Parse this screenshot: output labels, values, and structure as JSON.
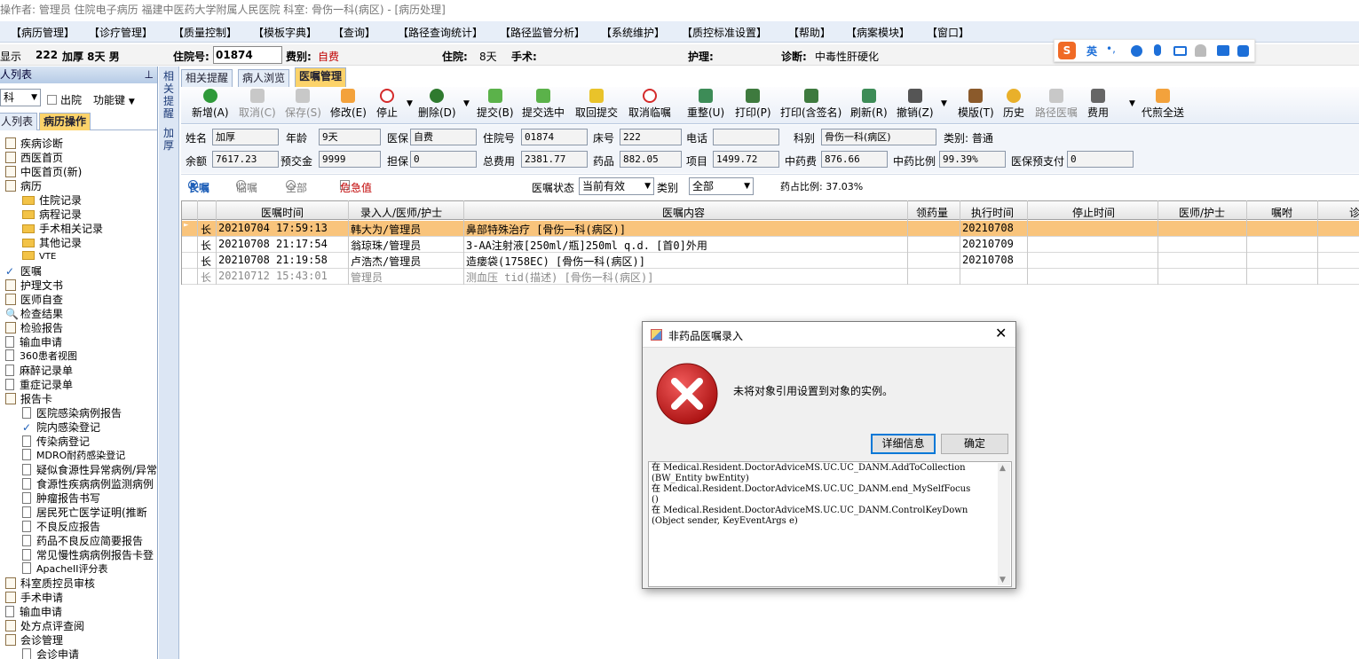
{
  "window": {
    "title": "操作者: 管理员 住院电子病历  福建中医药大学附属人民医院  科室: 骨伤一科(病区) - [病历处理]"
  },
  "menu": [
    "【病历管理】",
    "【诊疗管理】",
    "【质量控制】",
    "【模板字典】",
    "【查询】",
    "【路径查询统计】",
    "【路径监管分析】",
    "【系统维护】",
    "【质控标准设置】",
    "【帮助】",
    "【病案模块】",
    "【窗口】"
  ],
  "infobar": {
    "show": "显示",
    "bed": "222",
    "name_age": "加厚 8天 男",
    "inpatient_label": "住院号:",
    "inpatient_no": "01874",
    "fee_label": "费别:",
    "fee_value": "自费",
    "stay_label": "住院:",
    "stay_value": "8天",
    "surgery_label": "手术:",
    "nursing_label": "护理:",
    "diag_label": "诊断:",
    "diag_value": "中毒性肝硬化"
  },
  "ime": {
    "label": "英"
  },
  "sidebar": {
    "header": "人列表",
    "dept": "科",
    "discharged": "出院",
    "function_key": "功能键",
    "tab_patients": "人列表",
    "tab_ops": "病历操作",
    "items": [
      "疾病诊断",
      "西医首页",
      "中医首页(新)",
      "病历",
      "住院记录",
      "病程记录",
      "手术相关记录",
      "其他记录",
      "VTE",
      "医嘱",
      "护理文书",
      "医师自查",
      "检查结果",
      "检验报告",
      "输血申请",
      "360患者视图",
      "麻醉记录单",
      "重症记录单",
      "报告卡",
      "医院感染病例报告",
      "院内感染登记",
      "传染病登记",
      "MDRO耐药感染登记",
      "疑似食源性异常病例/异常",
      "食源性疾病病例监测病例",
      "肿瘤报告书写",
      "居民死亡医学证明(推断",
      "不良反应报告",
      "药品不良反应简要报告",
      "常见慢性病病例报告卡登",
      "ApacheII评分表",
      "科室质控员审核",
      "手术申请",
      "输血申请",
      "处方点评查阅",
      "会诊管理",
      "会诊申请"
    ]
  },
  "vstrip": {
    "remind": "相关提醒",
    "name": "加厚"
  },
  "tabs": [
    "相关提醒",
    "病人浏览",
    "医嘱管理"
  ],
  "toolbar": [
    "新增(A)",
    "取消(C)",
    "保存(S)",
    "修改(E)",
    "停止",
    "删除(D)",
    "提交(B)",
    "提交选中",
    "取回提交",
    "取消临嘱",
    "重整(U)",
    "打印(P)",
    "打印(含签名)",
    "刷新(R)",
    "撤销(Z)",
    "模版(T)",
    "历史",
    "路径医嘱",
    "费用",
    "代煎全送"
  ],
  "form": {
    "name_label": "姓名",
    "name": "加厚",
    "age_label": "年龄",
    "age": "9天",
    "ins_label": "医保",
    "ins": "自费",
    "inpatient_label": "住院号",
    "inpatient": "01874",
    "bed_label": "床号",
    "bed": "222",
    "phone_label": "电话",
    "phone": "",
    "dept_label": "科别",
    "dept": "骨伤一科(病区)",
    "category": "类别: 普通",
    "balance_label": "余额",
    "balance": "7617.23",
    "prepay_label": "预交金",
    "prepay": "9999",
    "guarantee_label": "担保",
    "guarantee": "0",
    "total_label": "总费用",
    "total": "2381.77",
    "drug_label": "药品",
    "drug": "882.05",
    "item_label": "项目",
    "item": "1499.72",
    "tcm_label": "中药费",
    "tcm": "876.66",
    "tcm_ratio_label": "中药比例",
    "tcm_ratio": "99.39%",
    "ins_prepay_label": "医保预支付",
    "ins_prepay": "0"
  },
  "filter": {
    "long": "长嘱",
    "temp": "临嘱",
    "all": "全部",
    "critical": "危急值",
    "status_label": "医嘱状态",
    "status": "当前有效",
    "type_label": "类别",
    "type": "全部",
    "drug_ratio": "药占比例: 37.03%"
  },
  "grid": {
    "columns": [
      "医嘱时间",
      "录入人/医师/护士",
      "医嘱内容",
      "领药量",
      "执行时间",
      "停止时间",
      "医师/护士",
      "嘱咐",
      "诊"
    ],
    "rows": [
      {
        "type": "长",
        "time": "20210704 17:59:13",
        "who": "韩大为/管理员",
        "content": "鼻部特殊治疗    [骨伤一科(病区)]",
        "exec": "20210708"
      },
      {
        "type": "长",
        "time": "20210708 21:17:54",
        "who": "翁琼珠/管理员",
        "content": "3-AA注射液[250ml/瓶]250ml q.d. [首0]外用",
        "exec": "20210709"
      },
      {
        "type": "长",
        "time": "20210708 21:19:58",
        "who": "卢浩杰/管理员",
        "content": "造瘘袋(1758EC)    [骨伤一科(病区)]",
        "exec": "20210708"
      },
      {
        "type": "长",
        "time": "20210712 15:43:01",
        "who": "管理员",
        "content": "测血压  tid(描述)    [骨伤一科(病区)]",
        "exec": ""
      }
    ]
  },
  "dialog": {
    "title": "非药品医嘱录入",
    "message": "未将对象引用设置到对象的实例。",
    "detail_btn": "详细信息",
    "ok_btn": "确定",
    "detail_lines": [
      "   在 Medical.Resident.DoctorAdviceMS.UC.UC_DANM.AddToCollection",
      "(BW_Entity bwEntity)",
      "   在 Medical.Resident.DoctorAdviceMS.UC.UC_DANM.end_MySelfFocus",
      "()",
      "   在 Medical.Resident.DoctorAdviceMS.UC.UC_DANM.ControlKeyDown",
      "(Object sender, KeyEventArgs e)"
    ]
  },
  "colors": {
    "accent": "#fcd36a",
    "selected_row": "#f9c47c",
    "error": "#d42b2b"
  }
}
